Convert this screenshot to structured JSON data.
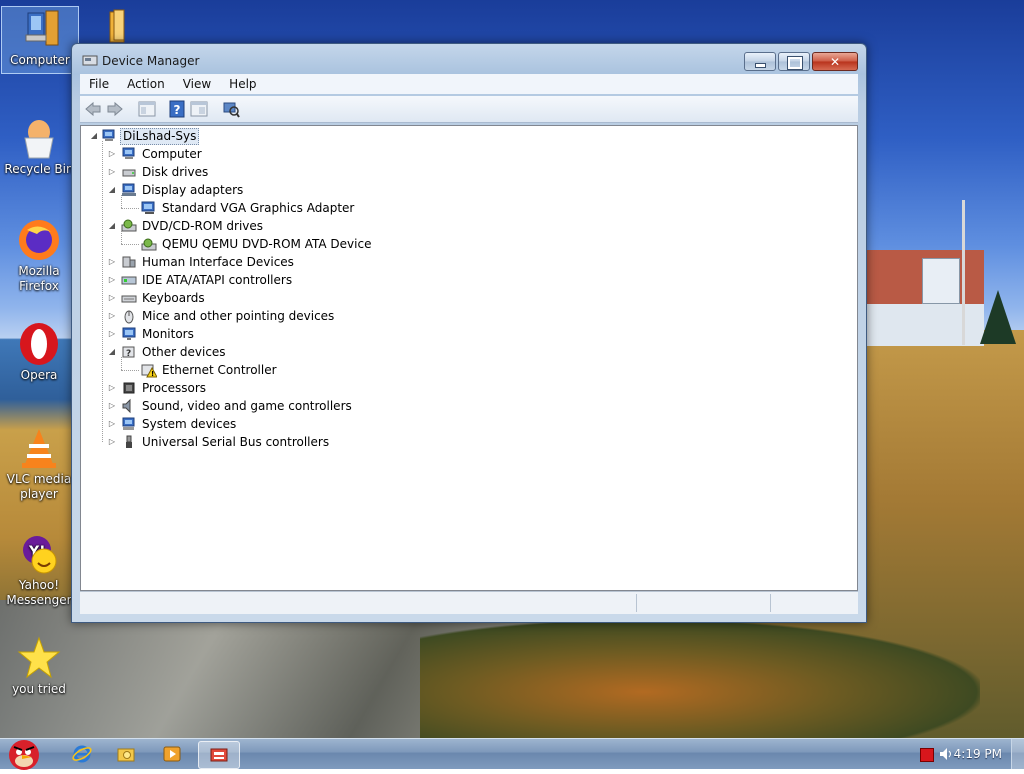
{
  "desktop": {
    "icons": [
      {
        "label": "Computer"
      },
      {
        "label": "Recycle Bin"
      },
      {
        "label": "Mozilla Firefox",
        "line1": "Mozilla",
        "line2": "Firefox"
      },
      {
        "label": "Opera"
      },
      {
        "label": "VLC media player",
        "line1": "VLC media",
        "line2": "player"
      },
      {
        "label": "Yahoo! Messenger",
        "line1": "Yahoo!",
        "line2": "Messenger"
      },
      {
        "label": "you tried"
      }
    ]
  },
  "window": {
    "title": "Device Manager",
    "menu": [
      "File",
      "Action",
      "View",
      "Help"
    ],
    "toolbar_icons": [
      "back-arrow-icon",
      "forward-arrow-icon",
      "properties-pane-icon",
      "help-icon",
      "console-tree-icon",
      "scan-hardware-icon"
    ],
    "tree": {
      "root": "DiLshad-Sys",
      "categories": [
        {
          "label": "Computer",
          "icon": "computer-icon",
          "expanded": false
        },
        {
          "label": "Disk drives",
          "icon": "disk-drive-icon",
          "expanded": false
        },
        {
          "label": "Display adapters",
          "icon": "display-adapter-icon",
          "expanded": true,
          "children": [
            "Standard VGA Graphics Adapter"
          ]
        },
        {
          "label": "DVD/CD-ROM drives",
          "icon": "dvd-drive-icon",
          "expanded": true,
          "children": [
            "QEMU QEMU DVD-ROM ATA Device"
          ]
        },
        {
          "label": "Human Interface Devices",
          "icon": "hid-icon",
          "expanded": false
        },
        {
          "label": "IDE ATA/ATAPI controllers",
          "icon": "ide-controller-icon",
          "expanded": false
        },
        {
          "label": "Keyboards",
          "icon": "keyboard-icon",
          "expanded": false
        },
        {
          "label": "Mice and other pointing devices",
          "icon": "mouse-icon",
          "expanded": false
        },
        {
          "label": "Monitors",
          "icon": "monitor-icon",
          "expanded": false
        },
        {
          "label": "Other devices",
          "icon": "unknown-device-icon",
          "expanded": true,
          "children": [
            "Ethernet Controller"
          ]
        },
        {
          "label": "Processors",
          "icon": "processor-icon",
          "expanded": false
        },
        {
          "label": "Sound, video and game controllers",
          "icon": "speaker-icon",
          "expanded": false
        },
        {
          "label": "System devices",
          "icon": "system-device-icon",
          "expanded": false
        },
        {
          "label": "Universal Serial Bus controllers",
          "icon": "usb-icon",
          "expanded": false
        }
      ]
    }
  },
  "taskbar": {
    "clock": "4:19 PM",
    "items": [
      "start-button",
      "internet-explorer",
      "windows-explorer",
      "media-player",
      "device-manager"
    ]
  },
  "colors": {
    "window_frame": "#aac3df",
    "selection": "#dfe9f5",
    "taskbar": "#7d98ba",
    "close_button": "#cd5a44"
  }
}
